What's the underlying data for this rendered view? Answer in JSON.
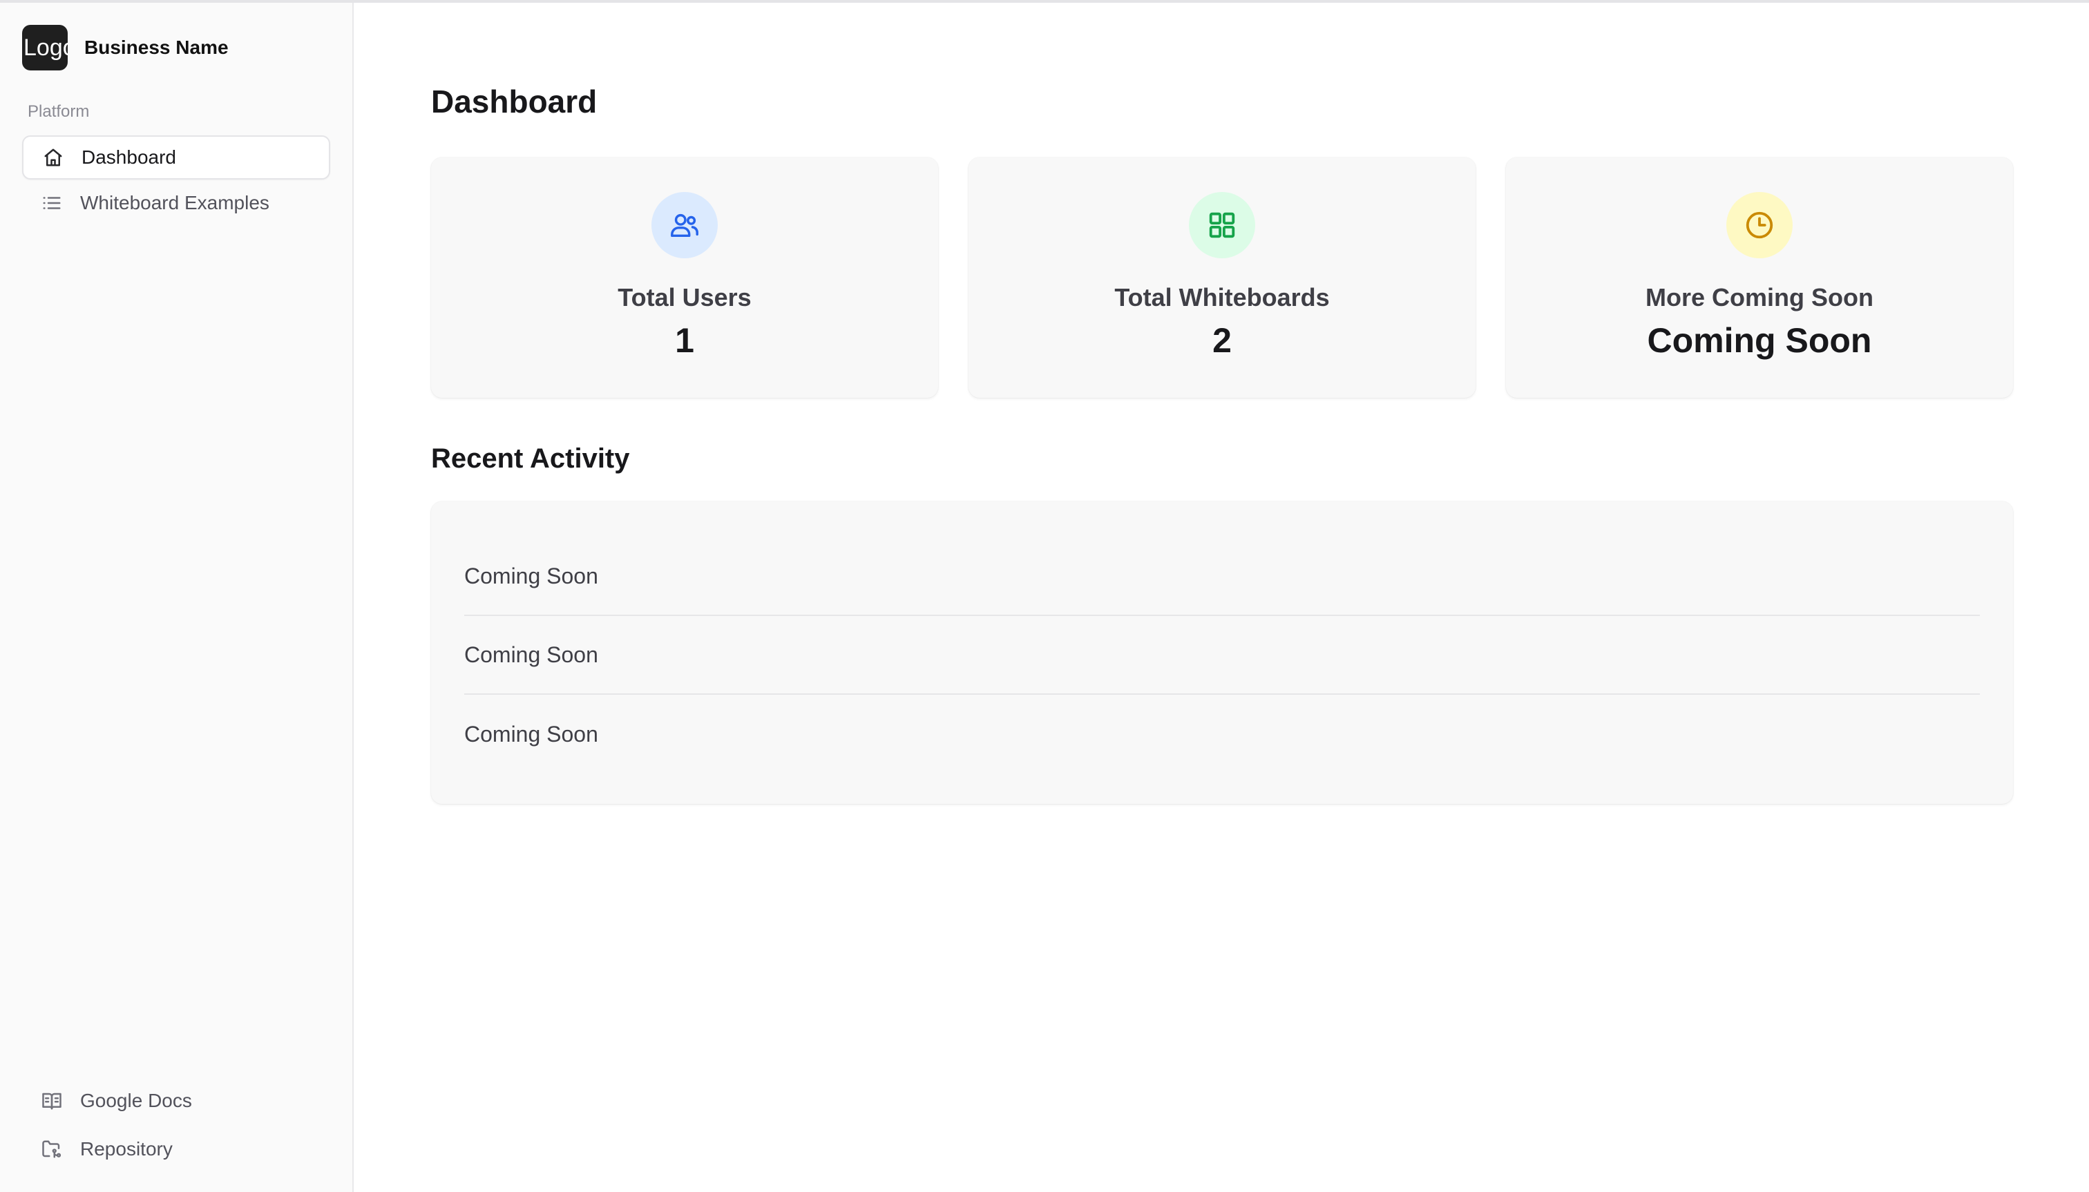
{
  "brand": {
    "logo_text": "Logo",
    "name": "Business Name"
  },
  "sidebar": {
    "group_label": "Platform",
    "items": [
      {
        "label": "Dashboard",
        "icon": "home-icon",
        "active": true
      },
      {
        "label": "Whiteboard Examples",
        "icon": "list-icon",
        "active": false
      }
    ],
    "footer_items": [
      {
        "label": "Google Docs",
        "icon": "book-open-icon"
      },
      {
        "label": "Repository",
        "icon": "folder-git-icon"
      }
    ]
  },
  "main": {
    "title": "Dashboard",
    "cards": [
      {
        "label": "Total Users",
        "value": "1",
        "icon": "users-icon",
        "color": "#2563eb"
      },
      {
        "label": "Total Whiteboards",
        "value": "2",
        "icon": "grid-icon",
        "color": "#16a34a"
      },
      {
        "label": "More Coming Soon",
        "value": "Coming Soon",
        "icon": "clock-icon",
        "color": "#ca8a04"
      }
    ],
    "recent_activity": {
      "title": "Recent Activity",
      "items": [
        "Coming Soon",
        "Coming Soon",
        "Coming Soon"
      ]
    }
  }
}
